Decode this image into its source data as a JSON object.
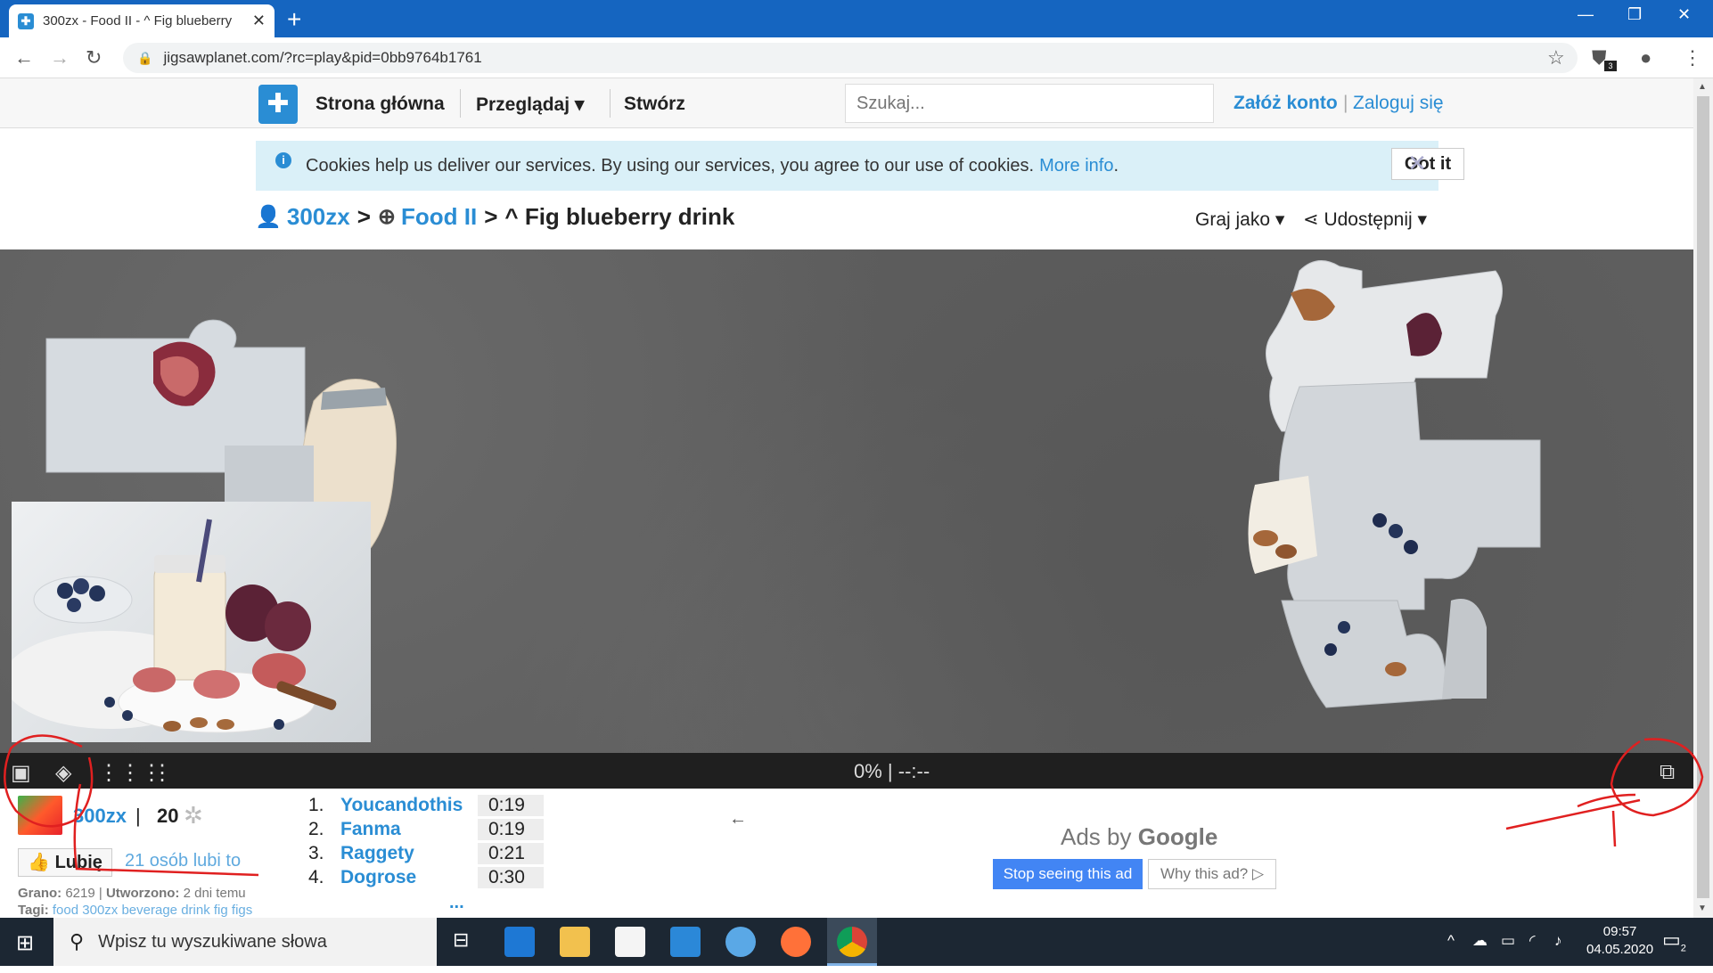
{
  "browser": {
    "tab_title": "300zx - Food II - ^ Fig blueberry",
    "new_tab_label": "+",
    "url": "jigsawplanet.com/?rc=play&pid=0bb9764b1761",
    "extension_badge": "3"
  },
  "site_nav": {
    "home": "Strona główna",
    "browse": "Przeglądaj",
    "create": "Stwórz",
    "search_placeholder": "Szukaj...",
    "signup": "Załóż konto",
    "login": "Zaloguj się"
  },
  "cookie": {
    "text": "Cookies help us deliver our services. By using our services, you agree to our use of cookies.",
    "more_info": "More info",
    "period": ".",
    "got_it": "Got it",
    "close": "×"
  },
  "breadcrumb": {
    "user": "300zx",
    "collection": "Food II",
    "current": "^ Fig blueberry drink",
    "separator": ">",
    "play_as": "Graj jako",
    "share": "Udostępnij"
  },
  "toolbar": {
    "progress": "0% | --:--"
  },
  "info": {
    "author": "300zx",
    "pipe": "|",
    "pieces": "20",
    "like_button": "Lubię",
    "likes_text": "21 osób lubi to",
    "played_label": "Grano:",
    "played_value": "6219",
    "created_label": "Utworzono:",
    "created_value": "2 dni temu",
    "tags_label": "Tagi:",
    "tags": [
      "food",
      "300zx",
      "beverage",
      "drink",
      "fig",
      "figs"
    ]
  },
  "scores": [
    {
      "rank": "1.",
      "name": "Youcandothis",
      "time": "0:19"
    },
    {
      "rank": "2.",
      "name": "Fanma",
      "time": "0:19"
    },
    {
      "rank": "3.",
      "name": "Raggety",
      "time": "0:21"
    },
    {
      "rank": "4.",
      "name": "Dogrose",
      "time": "0:30"
    }
  ],
  "scores_more": "...",
  "ad": {
    "ads_by": "Ads by",
    "google": "Google",
    "stop": "Stop seeing this ad",
    "why": "Why this ad? ▷"
  },
  "taskbar": {
    "search_placeholder": "Wpisz tu wyszukiwane słowa",
    "time": "09:57",
    "date": "04.05.2020",
    "notifications": "2"
  },
  "colors": {
    "accent": "#2a8dd4",
    "titlebar": "#1565c0",
    "puzzle_bg": "#5e5e5e",
    "toolbar_bg": "#1f1f1f",
    "taskbar_bg": "#1c2733",
    "annotation": "#e02020"
  }
}
